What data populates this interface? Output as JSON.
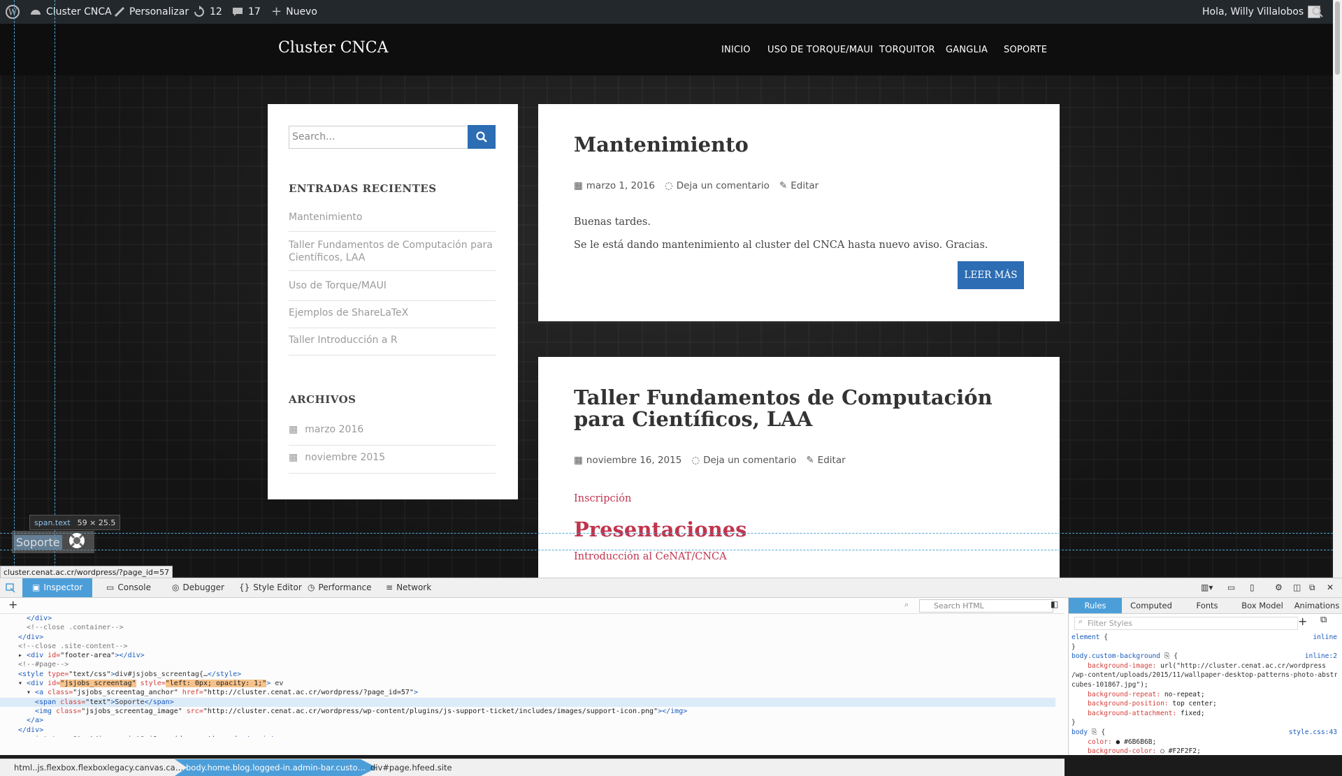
{
  "adminbar": {
    "site_name": "Cluster CNCA",
    "customize": "Personalizar",
    "updates": "12",
    "comments": "17",
    "new": "Nuevo",
    "greeting": "Hola, Willy Villalobos"
  },
  "site": {
    "title": "Cluster CNCA",
    "nav": [
      "INICIO",
      "USO DE TORQUE/MAUI",
      "TORQUITOR",
      "GANGLIA",
      "SOPORTE"
    ]
  },
  "sidebar": {
    "search_placeholder": "Search...",
    "recent_title": "ENTRADAS RECIENTES",
    "recent": [
      "Mantenimiento",
      "Taller Fundamentos de Computación para Científicos, LAA",
      "Uso de Torque/MAUI",
      "Ejemplos de ShareLaTeX",
      "Taller Introducción a R"
    ],
    "archives_title": "ARCHIVOS",
    "archives": [
      "marzo 2016",
      "noviembre 2015"
    ]
  },
  "post1": {
    "title": "Mantenimiento",
    "date": "marzo 1, 2016",
    "comment": "Deja un comentario",
    "edit": "Editar",
    "p1": "Buenas tardes.",
    "p2": "Se le está dando mantenimiento al cluster del CNCA hasta nuevo aviso. Gracias.",
    "read_more": "LEER MÁS"
  },
  "post2": {
    "title_line1": "Taller Fundamentos de Computación",
    "title_line2": "para Científicos, LAA",
    "date": "noviembre 16, 2015",
    "comment": "Deja un comentario",
    "edit": "Editar",
    "link1": "Inscripción",
    "heading": "Presentaciones",
    "link2": "Introducción al CeNAT/CNCA"
  },
  "overlay": {
    "tooltip_tag": "span.text",
    "tooltip_size": "59 × 25.5",
    "soporte": "Soporte",
    "status_url": "cluster.cenat.ac.cr/wordpress/?page_id=57"
  },
  "devtools": {
    "tabs": [
      "Inspector",
      "Console",
      "Debugger",
      "Style Editor",
      "Performance",
      "Network"
    ],
    "search_html": "Search HTML",
    "html_lines": [
      {
        "indent": 2,
        "html": "<span class='tag'>&lt;/div&gt;</span>"
      },
      {
        "indent": 2,
        "html": "<span class='cmt'>&lt;!--close .container--&gt;</span>"
      },
      {
        "indent": 1,
        "html": "<span class='tag'>&lt;/div&gt;</span>"
      },
      {
        "indent": 1,
        "html": "<span class='cmt'>&lt;!--close .site-content--&gt;</span>"
      },
      {
        "indent": 1,
        "html": "▸ <span class='tag'>&lt;div</span> <span class='attr'>id=</span><span class='val'>\"footer-area\"</span><span class='tag'>&gt;&lt;/div&gt;</span>"
      },
      {
        "indent": 1,
        "html": "<span class='cmt'>&lt;!--#page--&gt;</span>"
      },
      {
        "indent": 1,
        "html": "<span class='tag'>&lt;style</span> <span class='attr'>type=</span><span class='val'>\"text/css\"</span><span class='tag'>&gt;</span>div#jsjobs_screentag{…<span class='tag'>&lt;/style&gt;</span>"
      },
      {
        "indent": 1,
        "html": "▾ <span class='tag'>&lt;div</span> <span class='attr'>id=</span><span class='val hl'>\"jsjobs_screentag\"</span> <span class='attr'>style=</span><span class='val hl'>\"left: 0px; opacity: 1;\"</span><span class='tag'>&gt;</span> ev"
      },
      {
        "indent": 2,
        "html": "▾ <span class='tag'>&lt;a</span> <span class='attr'>class=</span><span class='val'>\"jsjobs_screentag_anchor\"</span> <span class='attr'>href=</span><span class='val'>\"http://cluster.cenat.ac.cr/wordpress/?page_id=57\"</span><span class='tag'>&gt;</span>"
      },
      {
        "indent": 3,
        "sel": true,
        "html": "<span class='tag'>&lt;span</span> <span class='attr'>class=</span><span class='val'>\"text\"</span><span class='tag'>&gt;</span>Soporte<span class='tag'>&lt;/span&gt;</span>"
      },
      {
        "indent": 3,
        "html": "<span class='tag'>&lt;img</span> <span class='attr'>class=</span><span class='val'>\"jsjobs_screentag_image\"</span> <span class='attr'>src=</span><span class='val'>\"http://cluster.cenat.ac.cr/wordpress/wp-content/plugins/js-support-ticket/includes/images/support-icon.png\"</span><span class='tag'>&gt;&lt;/img&gt;</span>"
      },
      {
        "indent": 2,
        "html": "<span class='tag'>&lt;/a&gt;</span>"
      },
      {
        "indent": 1,
        "html": "<span class='tag'>&lt;/div&gt;</span>"
      },
      {
        "indent": 1,
        "html": "<span class='tag'>&lt;script</span> <span class='attr'>type=</span><span class='val'>\"text/javascript\"</span><span class='tag'>&gt;</span>jQuery(document).read…<span class='tag'>&lt;/script&gt;</span>"
      }
    ],
    "breadcrumbs": [
      "html..js.flexbox.flexboxlegacy.canvas.ca…",
      "body.home.blog.logged-in.admin-bar.custo…",
      "div#page.hfeed.site"
    ],
    "rule_tabs": [
      "Rules",
      "Computed",
      "Fonts",
      "Box Model",
      "Animations"
    ],
    "filter_placeholder": "Filter Styles",
    "rules_html": [
      "<span class='rsel'>element</span> { <span class='rsrc'>inline</span>",
      "}",
      "<span class='rsel'>body.custom-background</span> ⎘ { <span class='rsrc'>inline:2</span>",
      "&nbsp;&nbsp;&nbsp;&nbsp;<span class='rprop'>background-image:</span> <span class='rval'>url(</span>\"http://cluster.cenat.ac.cr/wordpress",
      "/wp-content/uploads/2015/11/wallpaper-desktop-patterns-photo-abstract-",
      "cubes-101867.jpg\"<span class='rval'>);</span>",
      "&nbsp;&nbsp;&nbsp;&nbsp;<span class='rprop'>background-repeat:</span> <span class='rval'>no-repeat;</span>",
      "&nbsp;&nbsp;&nbsp;&nbsp;<span class='rprop'>background-position:</span> <span class='rval'>top center;</span>",
      "&nbsp;&nbsp;&nbsp;&nbsp;<span class='rprop'>background-attachment:</span> <span class='rval'>fixed;</span>",
      "}",
      "<span class='rsel'>body</span> ⎘ { <span class='rsrc'>style.css:43</span>",
      "&nbsp;&nbsp;&nbsp;&nbsp;<span class='rprop'>color:</span> <span class='rval'>● #6B6B6B;</span>",
      "&nbsp;&nbsp;&nbsp;&nbsp;<span class='rprop'>background-color:</span> <span class='rval'>○ #F2F2F2;</span>"
    ]
  }
}
